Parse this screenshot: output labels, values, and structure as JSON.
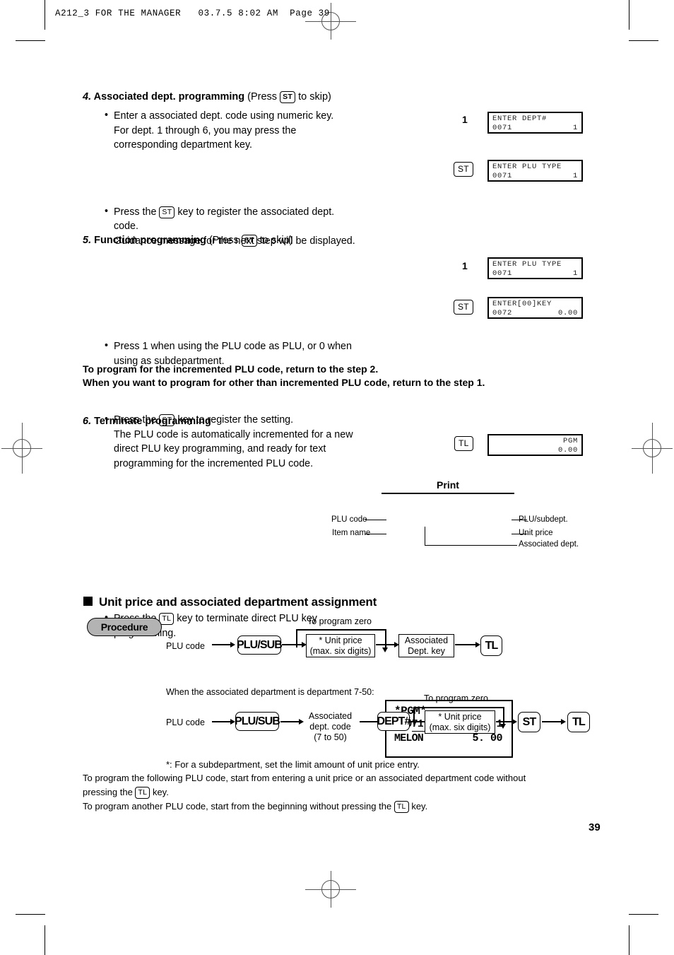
{
  "page": {
    "header": "A212_3 FOR THE MANAGER   03.7.5 8:02 AM  Page 39",
    "number": "39"
  },
  "step4": {
    "num": "4.",
    "title": "Associated dept. programming",
    "title_suffix_pre": "(Press",
    "key": "ST",
    "title_suffix_post": "to skip)",
    "bullet1_line1": "Enter a associated dept. code using numeric key.",
    "bullet1_line2": "For dept. 1 through 6, you may press the",
    "bullet1_line3": "corresponding department key.",
    "bullet2_pre": "Press the",
    "bullet2_key": "ST",
    "bullet2_post": "key to register the associated dept.",
    "bullet2_line2": "code.",
    "bullet2_line3": "Guidance message for the next step will be displayed.",
    "input1": "1",
    "input2_key": "ST",
    "display1": {
      "line1": "ENTER DEPT#",
      "left": "0071",
      "right": "1"
    },
    "display2": {
      "line1": "ENTER PLU TYPE",
      "left": "0071",
      "right": "1"
    }
  },
  "step5": {
    "num": "5.",
    "title": "Function programming",
    "title_suffix_pre": "(Press",
    "key": "ST",
    "title_suffix_post": "to skip)",
    "bullet1_line1": "Press 1 when using the PLU code as PLU, or 0 when",
    "bullet1_line2": "using as subdepartment.",
    "bullet2_pre": "Press the",
    "bullet2_key": "ST",
    "bullet2_post": "key to register the setting.",
    "bullet2_line2": "The PLU code is automatically incremented for a new",
    "bullet2_line3": "direct PLU key programming, and ready for text",
    "bullet2_line4": "programming for the incremented PLU code.",
    "input1": "1",
    "input2_key": "ST",
    "display1": {
      "line1": "ENTER PLU TYPE",
      "left": "0071",
      "right": "1"
    },
    "display2": {
      "line1": "ENTER[00]KEY",
      "left": "0072",
      "right": "0.00"
    }
  },
  "notes": {
    "line1": "To program for the incremented PLU code, return to the step 2.",
    "line2": "When you want to program for other than incremented PLU code, return to the step 1."
  },
  "step6": {
    "num": "6.",
    "title": "Terminate programming",
    "bullet_pre": "Press the",
    "bullet_key": "TL",
    "bullet_post": "key to terminate direct PLU key",
    "bullet_line2": "programming.",
    "input_key": "TL",
    "display": {
      "line1": "PGM",
      "line2": "0.00"
    }
  },
  "print": {
    "label": "Print",
    "pgm": "*PGM*",
    "plu_code_text": "P0071(O1)",
    "item_name": "MELON",
    "value_right_1": "1",
    "value_right_2": "5. 00",
    "left_label_1": "PLU code",
    "left_label_2": "Item name",
    "right_label_1": "PLU/subdept.",
    "right_label_2": "Unit price",
    "right_label_3": "Associated dept."
  },
  "section": {
    "heading": "Unit price and associated department assignment",
    "procedure_badge": "Procedure"
  },
  "flow1": {
    "note_zero": "To program zero",
    "plu_code": "PLU code",
    "key_plusub": "PLU/SUB",
    "unit_price_l1": "*  Unit price",
    "unit_price_l2": "(max. six digits)",
    "assoc_l1": "Associated",
    "assoc_l2": "Dept. key",
    "key_tl": "TL"
  },
  "flow2": {
    "intro": "When the associated department is department 7-50:",
    "note_zero": "To program zero",
    "plu_code": "PLU code",
    "key_plusub": "PLU/SUB",
    "assoc_l1": "Associated",
    "assoc_l2": "dept. code",
    "assoc_l3": "(7 to 50)",
    "key_dept": "DEPT#",
    "unit_price_l1": "*  Unit price",
    "unit_price_l2": "(max. six digits)",
    "key_st": "ST",
    "key_tl": "TL"
  },
  "footnote": {
    "star": "*: For a subdepartment, set the limit amount of unit price entry.",
    "line1a": "To program the following PLU code, start from entering a unit price or an associated department code without",
    "line1b_pre": "pressing the",
    "line1b_key": "TL",
    "line1b_post": "key.",
    "line2_pre": "To program another PLU code, start from the beginning without pressing the",
    "line2_key": "TL",
    "line2_post": "key."
  }
}
